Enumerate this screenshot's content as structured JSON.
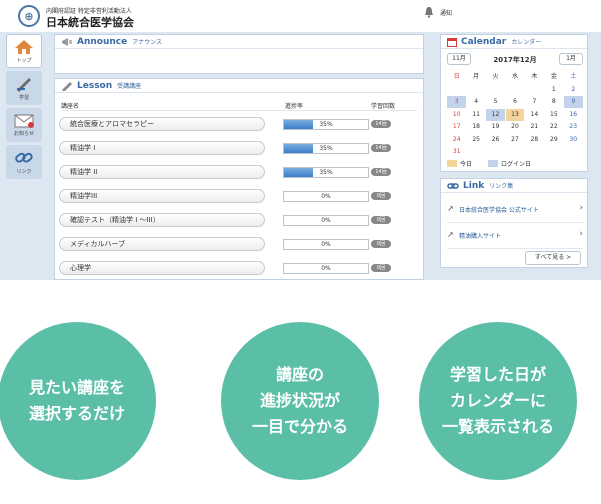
{
  "header": {
    "org_sub": "内閣府認証 特定非営利活動法人",
    "org_name": "日本統合医学協会",
    "logo_glyph": "⊕",
    "notice_label": "通知"
  },
  "sidenav": [
    {
      "label": "トップ",
      "icon": "home-icon"
    },
    {
      "label": "学習",
      "icon": "study-icon"
    },
    {
      "label": "お知らせ",
      "icon": "mail-icon"
    },
    {
      "label": "リンク",
      "icon": "chain-link-icon"
    }
  ],
  "announce": {
    "title": "Announce",
    "subtitle": "アナウンス"
  },
  "lesson": {
    "title": "Lesson",
    "subtitle": "受講講座",
    "col_name": "講座名",
    "col_progress": "進捗率",
    "col_count": "学習回数",
    "rows": [
      {
        "name": "統合医療とアロマセラピー",
        "progress": "35%",
        "fill": 0.35,
        "count": "14回"
      },
      {
        "name": "精油学 I",
        "progress": "35%",
        "fill": 0.35,
        "count": "14回"
      },
      {
        "name": "精油学 II",
        "progress": "35%",
        "fill": 0.35,
        "count": "14回"
      },
      {
        "name": "精油学III",
        "progress": "0%",
        "fill": 0,
        "count": "0回"
      },
      {
        "name": "確認テスト（精油学 I ～III）",
        "progress": "0%",
        "fill": 0,
        "count": "0回"
      },
      {
        "name": "メディカルハーブ",
        "progress": "0%",
        "fill": 0,
        "count": "0回"
      },
      {
        "name": "心理学",
        "progress": "0%",
        "fill": 0,
        "count": "0回"
      }
    ]
  },
  "calendar": {
    "title": "Calendar",
    "subtitle": "カレンダー",
    "prev": "11月",
    "next": "1月",
    "month": "2017年12月",
    "weekdays": [
      "日",
      "月",
      "火",
      "水",
      "木",
      "金",
      "土"
    ],
    "weeks": [
      [
        "",
        "",
        "",
        "",
        "",
        "1",
        "2"
      ],
      [
        "3",
        "4",
        "5",
        "6",
        "7",
        "8",
        "9"
      ],
      [
        "10",
        "11",
        "12",
        "13",
        "14",
        "15",
        "16"
      ],
      [
        "17",
        "18",
        "19",
        "20",
        "21",
        "22",
        "23"
      ],
      [
        "24",
        "25",
        "26",
        "27",
        "28",
        "29",
        "30"
      ],
      [
        "31",
        "",
        "",
        "",
        "",
        "",
        ""
      ]
    ],
    "today": "13",
    "login_days": [
      "3",
      "9",
      "12"
    ],
    "legend_today": "今日",
    "legend_login": "ログイン日",
    "colors": {
      "today": "#f3d59b",
      "login": "#c3d3ec",
      "sunday": "#d23c3c",
      "saturday": "#3a5fb0"
    }
  },
  "links": {
    "title": "Link",
    "subtitle": "リンク集",
    "items": [
      "日本統合医学協会 公式サイト",
      "精油購入サイト"
    ],
    "more": "すべて見る >"
  },
  "features": [
    {
      "line1": "見たい講座を",
      "line2": "選択するだけ",
      "line3": ""
    },
    {
      "line1": "講座の",
      "line2": "進捗状況が",
      "line3": "一目で分かる"
    },
    {
      "line1": "学習した日が",
      "line2": "カレンダーに",
      "line3": "一覧表示される"
    }
  ]
}
